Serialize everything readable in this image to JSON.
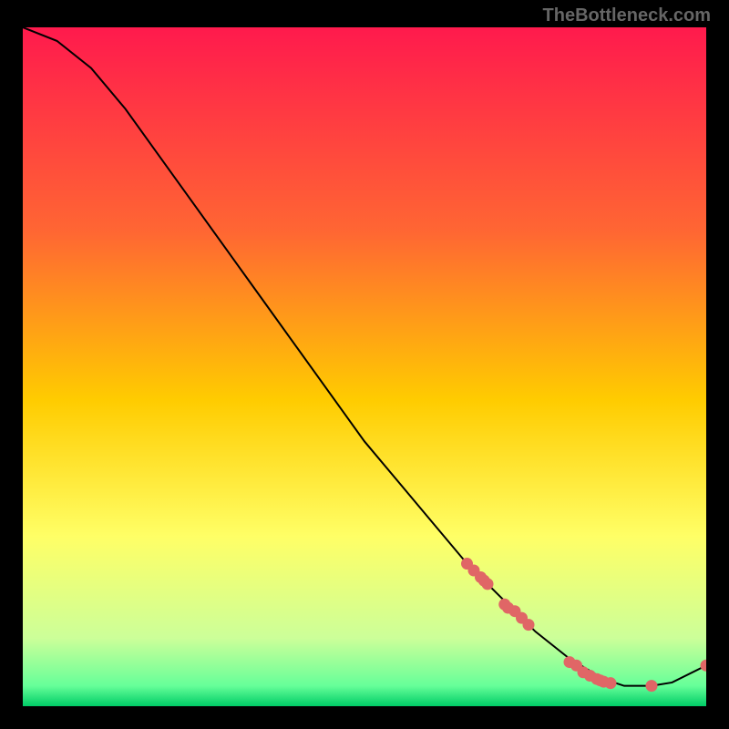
{
  "watermark": "TheBottleneck.com",
  "chart_data": {
    "type": "line",
    "title": "",
    "xlabel": "",
    "ylabel": "",
    "xlim": [
      0,
      100
    ],
    "ylim": [
      0,
      100
    ],
    "line": {
      "x": [
        0,
        5,
        10,
        15,
        20,
        25,
        30,
        35,
        40,
        45,
        50,
        55,
        60,
        65,
        70,
        75,
        80,
        85,
        88,
        92,
        95,
        100
      ],
      "y": [
        100,
        98,
        94,
        88,
        81,
        74,
        67,
        60,
        53,
        46,
        39,
        33,
        27,
        21,
        16,
        11,
        7,
        4,
        3,
        3,
        3.5,
        6
      ]
    },
    "points": {
      "x": [
        65,
        66,
        67,
        67.5,
        68,
        70.5,
        71,
        72,
        73,
        74,
        80,
        81,
        82,
        83,
        84,
        84.5,
        85,
        86,
        92,
        100
      ],
      "y": [
        21,
        20,
        19,
        18.5,
        18,
        15,
        14.5,
        14,
        13,
        12,
        6.5,
        6,
        5,
        4.5,
        4,
        3.8,
        3.6,
        3.4,
        3,
        6
      ]
    },
    "gradient_stops": [
      {
        "offset": 0,
        "color": "#ff1a4d"
      },
      {
        "offset": 30,
        "color": "#ff6633"
      },
      {
        "offset": 55,
        "color": "#ffcc00"
      },
      {
        "offset": 75,
        "color": "#ffff66"
      },
      {
        "offset": 90,
        "color": "#ccff99"
      },
      {
        "offset": 97,
        "color": "#66ff99"
      },
      {
        "offset": 100,
        "color": "#00cc66"
      }
    ]
  }
}
